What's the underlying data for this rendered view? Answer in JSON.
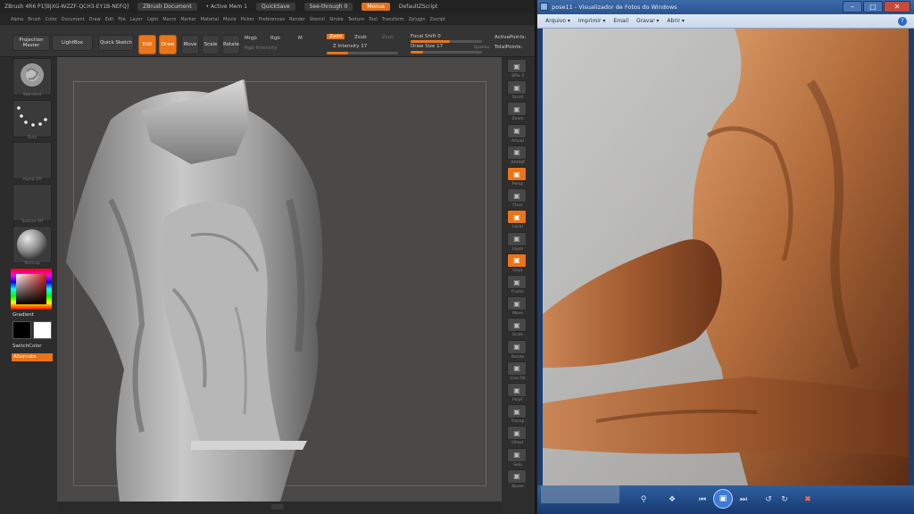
{
  "zbrush": {
    "title_left": "ZBrush 4R6  P1[BJXG-WZZF-QCH3-EY1B-NEFQ]",
    "document": "ZBrush Document",
    "active_mem": "• Active Mem 1",
    "quicksave": "QuickSave",
    "see_through": "See-through  0",
    "menus_btn": "Menus",
    "default_script": "DefaultZScript",
    "menus": [
      "Alpha",
      "Brush",
      "Color",
      "Document",
      "Draw",
      "Edit",
      "File",
      "Layer",
      "Light",
      "Macro",
      "Marker",
      "Material",
      "Movie",
      "Picker",
      "Preferences",
      "Render",
      "Stencil",
      "Stroke",
      "Texture",
      "Tool",
      "Transform",
      "Zplugin",
      "Zscript"
    ],
    "shelf": {
      "projection_master": "Projection Master",
      "lightbox": "LightBox",
      "quick_sketch": "Quick Sketch",
      "edit": "Edit",
      "draw": "Draw",
      "move": "Move",
      "scale": "Scale",
      "rotate": "Rotate",
      "mrgb": "Mrgb",
      "rgb": "Rgb",
      "m": "M",
      "rgb_intensity": "Rgb Intensity",
      "zadd": "Zadd",
      "zsub": "Zsub",
      "zcut": "Zcut",
      "z_intensity": "Z Intensity 17",
      "focal_shift": "Focal Shift 0",
      "draw_size": "Draw Size 17",
      "dynamic": "Dynamic",
      "active_points": "ActivePoints:",
      "total_points": "TotalPoints:"
    },
    "left": {
      "tiles": [
        "Standard",
        "Dots",
        "Alpha Off",
        "Texture Off",
        "MatCap"
      ],
      "gradient": "Gradient",
      "switch_color": "SwitchColor",
      "alternate": "Alternate"
    },
    "right": [
      {
        "label": "SPix 3",
        "icon": "spix-icon"
      },
      {
        "label": "Scroll",
        "icon": "scroll-icon"
      },
      {
        "label": "Zoom",
        "icon": "zoom-icon"
      },
      {
        "label": "Actual",
        "icon": "actual-icon"
      },
      {
        "label": "AAHalf",
        "icon": "aahalf-icon"
      },
      {
        "label": "Persp",
        "icon": "persp-icon"
      },
      {
        "label": "Floor",
        "icon": "floor-icon"
      },
      {
        "label": "Local",
        "icon": "local-icon"
      },
      {
        "label": "LSym",
        "icon": "lsym-icon"
      },
      {
        "label": "Gxyz",
        "icon": "gxyz-icon"
      },
      {
        "label": "Frame",
        "icon": "frame-icon"
      },
      {
        "label": "Move",
        "icon": "move-icon"
      },
      {
        "label": "Scale",
        "icon": "scale-icon"
      },
      {
        "label": "Rotate",
        "icon": "rotate-icon"
      },
      {
        "label": "Line Fill",
        "icon": "linefill-icon"
      },
      {
        "label": "PolyF",
        "icon": "polyf-icon"
      },
      {
        "label": "Transp",
        "icon": "transp-icon"
      },
      {
        "label": "Ghost",
        "icon": "ghost-icon"
      },
      {
        "label": "Solo",
        "icon": "solo-icon"
      },
      {
        "label": "Xpose",
        "icon": "xpose-icon"
      }
    ],
    "colors": {
      "accent": "#e8751a",
      "canvas": "#4b4948"
    }
  },
  "viewer": {
    "title": "pose11 - Visualizador de Fotos do Windows",
    "menu": [
      "Arquivo ▾",
      "Imprimir ▾",
      "Email",
      "Gravar ▾",
      "Abrir ▾"
    ],
    "help": "?"
  }
}
